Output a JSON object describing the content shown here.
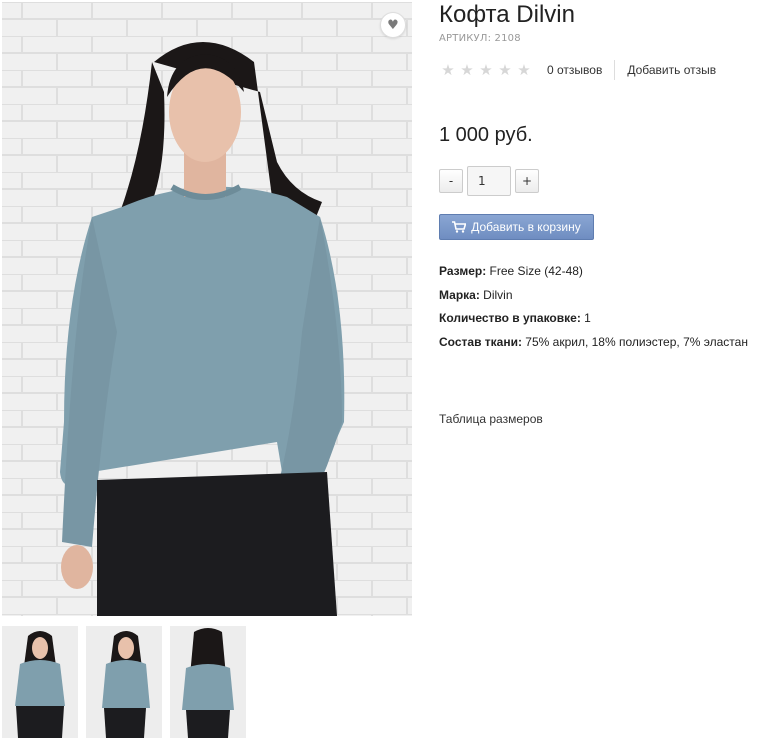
{
  "product": {
    "title": "Кофта Dilvin",
    "sku": "АРТИКУЛ: 2108",
    "reviews_count": "0 отзывов",
    "add_review": "Добавить отзыв",
    "rating_value": 0,
    "rating_max": 5,
    "price": "1 000 руб.",
    "quantity": "1",
    "qty_minus": "-",
    "qty_plus": "+",
    "add_to_cart": "Добавить в корзину",
    "wishlist_icon": "heart-icon",
    "cart_icon": "cart-icon",
    "properties": [
      {
        "label": "Размер:",
        "value": " Free Size (42-48)"
      },
      {
        "label": "Марка:",
        "value": " Dilvin"
      },
      {
        "label": "Количество в упаковке:",
        "value": " 1"
      },
      {
        "label": "Состав ткани:",
        "value": " 75% акрил, 18% полиэстер, 7% эластан"
      }
    ],
    "size_table_link": "Таблица размеров"
  },
  "colors": {
    "accent_button": "#7a96c8",
    "sweater": "#7f9fad",
    "star_empty": "#d7d7d7"
  }
}
